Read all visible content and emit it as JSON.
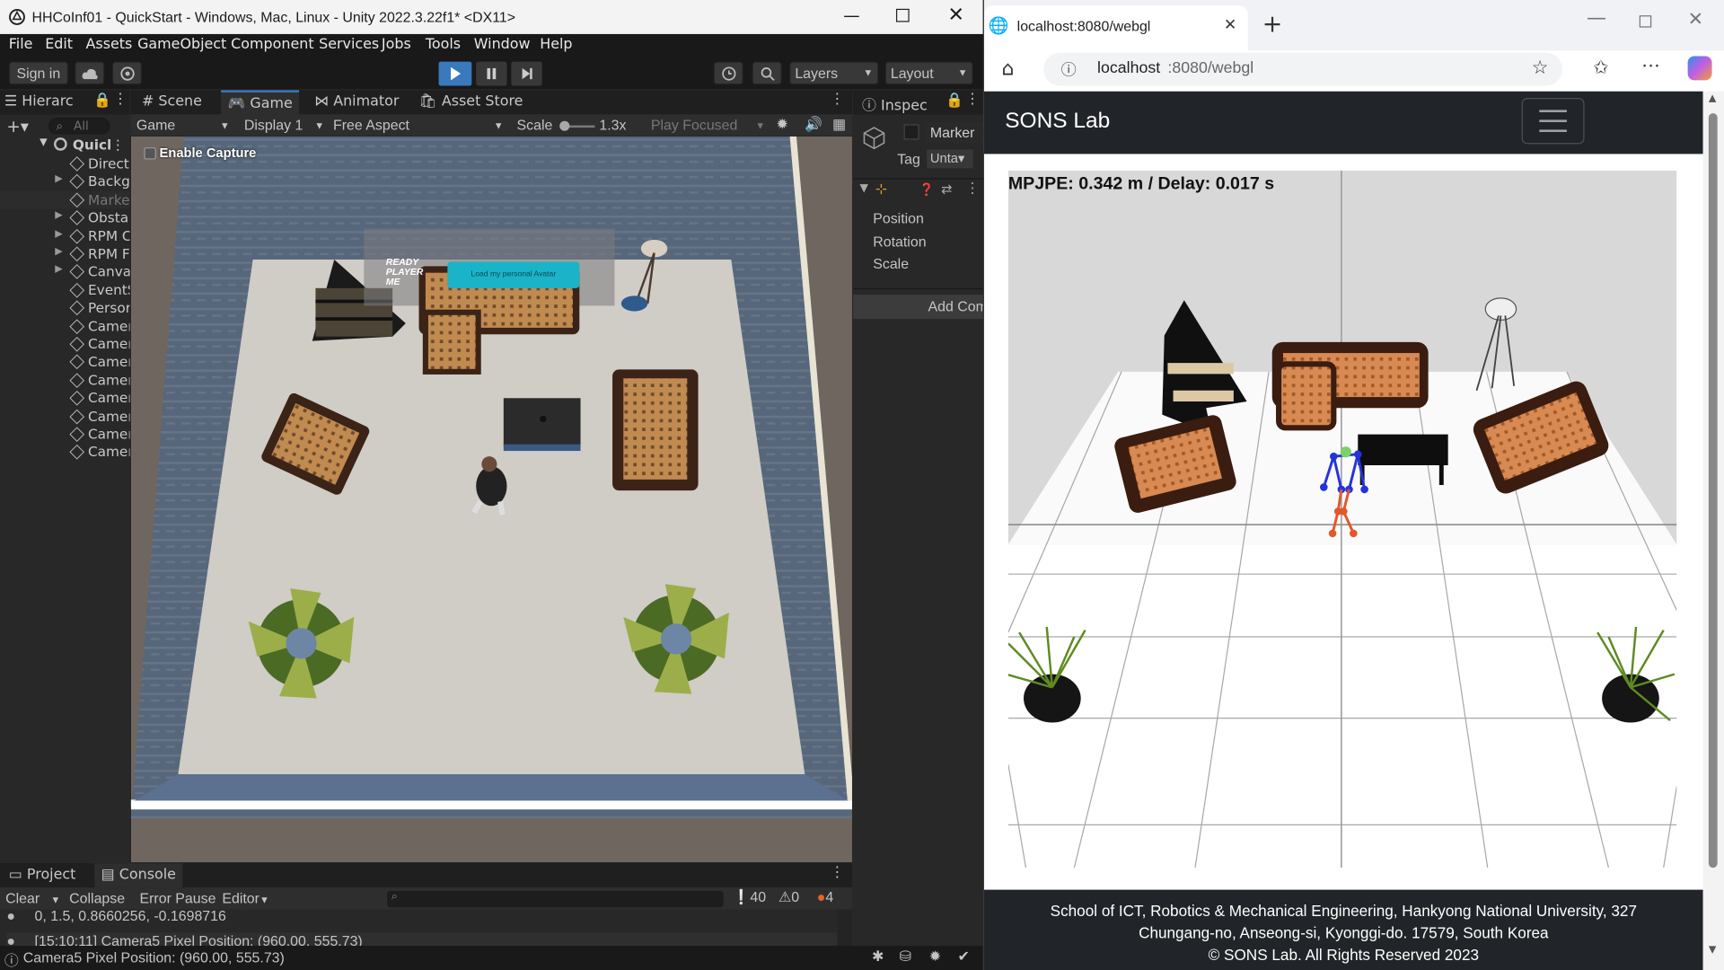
{
  "unity": {
    "window_title": "HHCoInf01 - QuickStart - Windows, Mac, Linux - Unity 2022.3.22f1* <DX11>",
    "menu": [
      "File",
      "Edit",
      "Assets",
      "GameObject",
      "Component",
      "Services",
      "Jobs",
      "Tools",
      "Window",
      "Help"
    ],
    "toolbar": {
      "sign_in": "Sign in",
      "layers": "Layers",
      "layout": "Layout"
    },
    "tabs": {
      "hierarchy": "Hierarc",
      "scene": "Scene",
      "game": "Game",
      "animator": "Animator",
      "asset_store": "Asset Store",
      "inspector": "Inspec"
    },
    "hierarchy": {
      "search_placeholder": "All",
      "root": "Quicl",
      "items": [
        "Direct",
        "Backg",
        "Marke",
        "Obsta",
        "RPM C",
        "RPM F",
        "Canva",
        "EventS",
        "Persor",
        "Camer",
        "Camer",
        "Camer",
        "Camer",
        "Camer",
        "Camer",
        "Camer",
        "Camer"
      ]
    },
    "game_bar": {
      "view": "Game",
      "display": "Display 1",
      "aspect": "Free Aspect",
      "scale_label": "Scale",
      "scale_value": "1.3x",
      "play_mode": "Play Focused"
    },
    "game_view": {
      "enable_capture": "Enable Capture",
      "rpm_logo": "READY PLAYER ME",
      "rpm_button": "Load my personal Avatar"
    },
    "inspector": {
      "object_name": "Marker",
      "tag_label": "Tag",
      "tag_value": "Unta",
      "position": "Position",
      "rotation": "Rotation",
      "scale": "Scale",
      "add_component": "Add Com"
    },
    "bottom_tabs": {
      "project": "Project",
      "console": "Console"
    },
    "console": {
      "clear": "Clear",
      "collapse": "Collapse",
      "error_pause": "Error Pause",
      "editor": "Editor",
      "count_info": "40",
      "count_warn": "0",
      "count_error": "4",
      "log_lines": [
        "0, 1.5, 0.8660256, -0.1698716",
        "[15:10:11] Camera5 Pixel Position: (960.00, 555.73)"
      ]
    },
    "status_bar": "Camera5 Pixel Position: (960.00, 555.73)"
  },
  "browser": {
    "tab_title": "localhost:8080/webgl",
    "url_host": "localhost",
    "url_path": ":8080/webgl",
    "site_title": "SONS Lab",
    "overlay_text": "MPJPE: 0.342 m / Delay: 0.017 s",
    "footer_line1": "School of ICT, Robotics & Mechanical Engineering, Hankyong National University, 327",
    "footer_line2": "Chungang-no, Anseong-si, Kyonggi-do. 17579, South Korea",
    "footer_line3": "© SONS Lab. All Rights Reserved 2023"
  },
  "colors": {
    "unity_blue": "#3a79bb",
    "rpm_cyan": "#1bb3c8",
    "navbar_dark": "#212529",
    "skeleton_blue": "#2233dd",
    "skeleton_orange": "#e2572b"
  }
}
